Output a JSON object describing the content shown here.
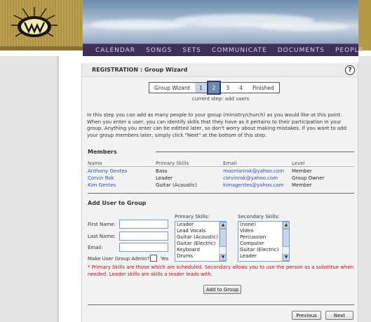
{
  "nav": {
    "items": [
      "CALENDAR",
      "SONGS",
      "SETS",
      "COMMUNICATE",
      "DOCUMENTS",
      "PEOPLE"
    ]
  },
  "panel": {
    "title": "REGISTRATION : Group Wizard",
    "help": "?"
  },
  "wizard": {
    "label": "Group Wizard",
    "steps": [
      "1",
      "2",
      "3",
      "4"
    ],
    "active_step": "2",
    "finished": "Finished",
    "current_step_text": "current step: add users"
  },
  "intro": "In this step you can add as many people to your group (ministry/church) as you would like at this point. When you enter a user, you can identify skills that they have as it pertains to their participation in your group. Anything you enter can be editted later, so don't worry about making mistakes. If you want to add your group members later, simply click \"Next\" at the bottom of this step.",
  "members": {
    "title": "Members",
    "columns": [
      "Name",
      "Primary Skills",
      "Email",
      "Level"
    ],
    "rows": [
      {
        "name": "Anthony Gentes",
        "skills": "Bass",
        "email": "moonlanrok@yahoo.com",
        "level": "Member"
      },
      {
        "name": "Corvin Rok",
        "skills": "Leader",
        "email": "corvinrok@yahoo.com",
        "level": "Group Owner"
      },
      {
        "name": "Kim Gentes",
        "skills": "Guitar (Acoustic)",
        "email": "kimagentes@yahoo.com",
        "level": "Member"
      }
    ]
  },
  "add_user": {
    "title": "Add User to Group",
    "first_name_label": "First Name:",
    "last_name_label": "Last Name:",
    "email_label": "Email:",
    "admin_label": "Make User Group Admin?",
    "admin_yes": "Yes",
    "primary_label": "Primary Skills:",
    "primary_options": [
      "Leader",
      "Lead Vocals",
      "Guitar (Acoustic)",
      "Guitar (Electric)",
      "Keyboard",
      "Drums"
    ],
    "secondary_label": "Secondary Skills:",
    "secondary_options": [
      "(none)",
      "Video",
      "Percussion",
      "Computer",
      "Guitar (Electric)",
      "Leader"
    ],
    "note": "* Primary Skills are those which are scheduled. Secondary allows you to use the person as a substitue when needed. Leader skills are skills a leader leads with.",
    "add_button": "Add to Group"
  },
  "footer": {
    "previous": "Previous",
    "next": "Next"
  }
}
